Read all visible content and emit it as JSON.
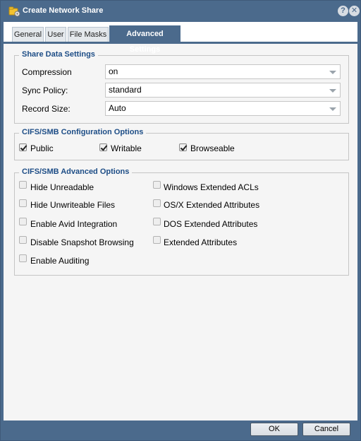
{
  "dialog": {
    "title": "Create Network Share",
    "help_label": "?",
    "close_label": "✕"
  },
  "tabs": [
    {
      "label": "General",
      "active": false
    },
    {
      "label": "User",
      "active": false
    },
    {
      "label": "File Masks",
      "active": false
    },
    {
      "label": "Advanced Settings",
      "active": true
    }
  ],
  "share_data": {
    "legend": "Share Data Settings",
    "fields": [
      {
        "label": "Compression",
        "value": "on"
      },
      {
        "label": "Sync Policy:",
        "value": "standard"
      },
      {
        "label": "Record Size:",
        "value": "Auto"
      }
    ]
  },
  "cifs_config": {
    "legend": "CIFS/SMB Configuration Options",
    "options": [
      {
        "label": "Public",
        "checked": true
      },
      {
        "label": "Writable",
        "checked": true
      },
      {
        "label": "Browseable",
        "checked": true
      }
    ]
  },
  "cifs_advanced": {
    "legend": "CIFS/SMB Advanced Options",
    "left": [
      {
        "label": "Hide Unreadable",
        "checked": false
      },
      {
        "label": "Hide Unwriteable Files",
        "checked": false
      },
      {
        "label": "Enable Avid Integration",
        "checked": false
      },
      {
        "label": "Disable Snapshot Browsing",
        "checked": false
      },
      {
        "label": "Enable Auditing",
        "checked": false
      }
    ],
    "right": [
      {
        "label": "Windows Extended ACLs",
        "checked": false
      },
      {
        "label": "OS/X Extended Attributes",
        "checked": false
      },
      {
        "label": "DOS Extended Attributes",
        "checked": false
      },
      {
        "label": "Extended Attributes",
        "checked": false
      }
    ]
  },
  "footer": {
    "ok_label": "OK",
    "cancel_label": "Cancel"
  }
}
